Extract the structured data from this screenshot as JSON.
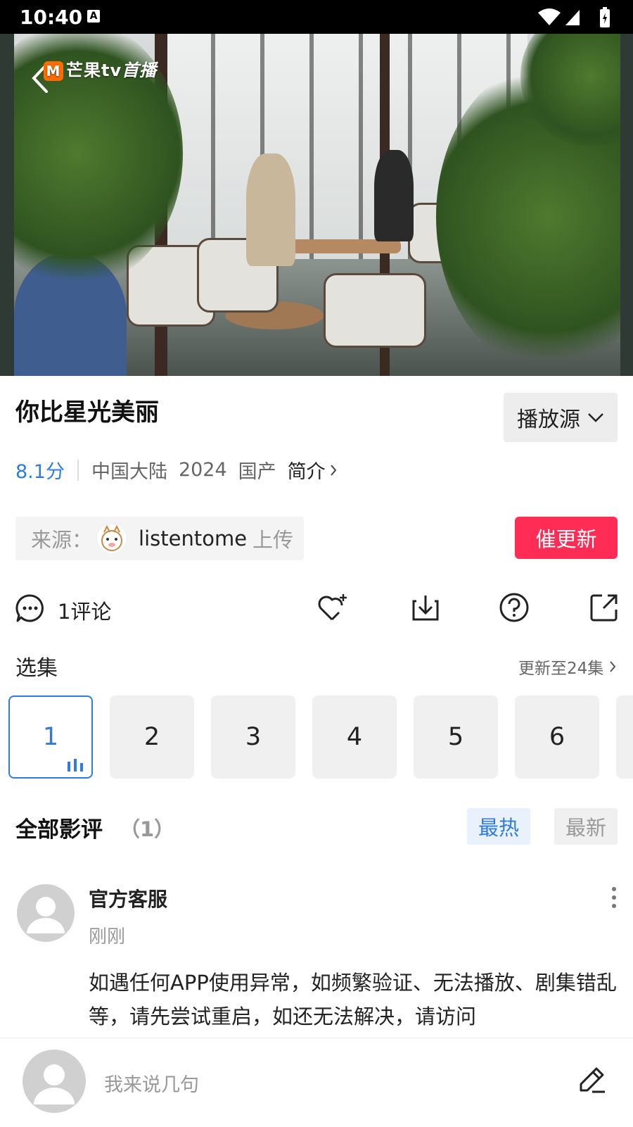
{
  "status_bar": {
    "time": "10:40",
    "notif_icon": "A"
  },
  "video": {
    "brand": "芒果tv",
    "brand_live": "首播"
  },
  "show": {
    "title": "你比星光美丽",
    "source_button": "播放源",
    "score": "8.1分",
    "region": "中国大陆",
    "year": "2024",
    "origin": "国产",
    "intro_label": "简介"
  },
  "uploader": {
    "label": "来源：",
    "name": "listentome",
    "action": "上传",
    "urge_button": "催更新"
  },
  "actions": {
    "comment_count": "1评论",
    "icons": [
      "comment-icon",
      "favorite-add-icon",
      "download-icon",
      "help-icon",
      "share-icon"
    ]
  },
  "episodes": {
    "title": "选集",
    "more_label": "更新至24集",
    "items": [
      "1",
      "2",
      "3",
      "4",
      "5",
      "6"
    ],
    "active": "1"
  },
  "reviews": {
    "title": "全部影评",
    "count": "（1）",
    "tab_hot": "最热",
    "tab_new": "最新",
    "items": [
      {
        "user": "官方客服",
        "time": "刚刚",
        "body": "如遇任何APP使用异常，如频繁验证、无法播放、剧集错乱等，请先尝试重启，如还无法解决，请访问"
      }
    ]
  },
  "bottom_bar": {
    "placeholder": "我来说几句"
  },
  "colors": {
    "accent": "#2f7be6",
    "urge": "#ff2d55"
  }
}
